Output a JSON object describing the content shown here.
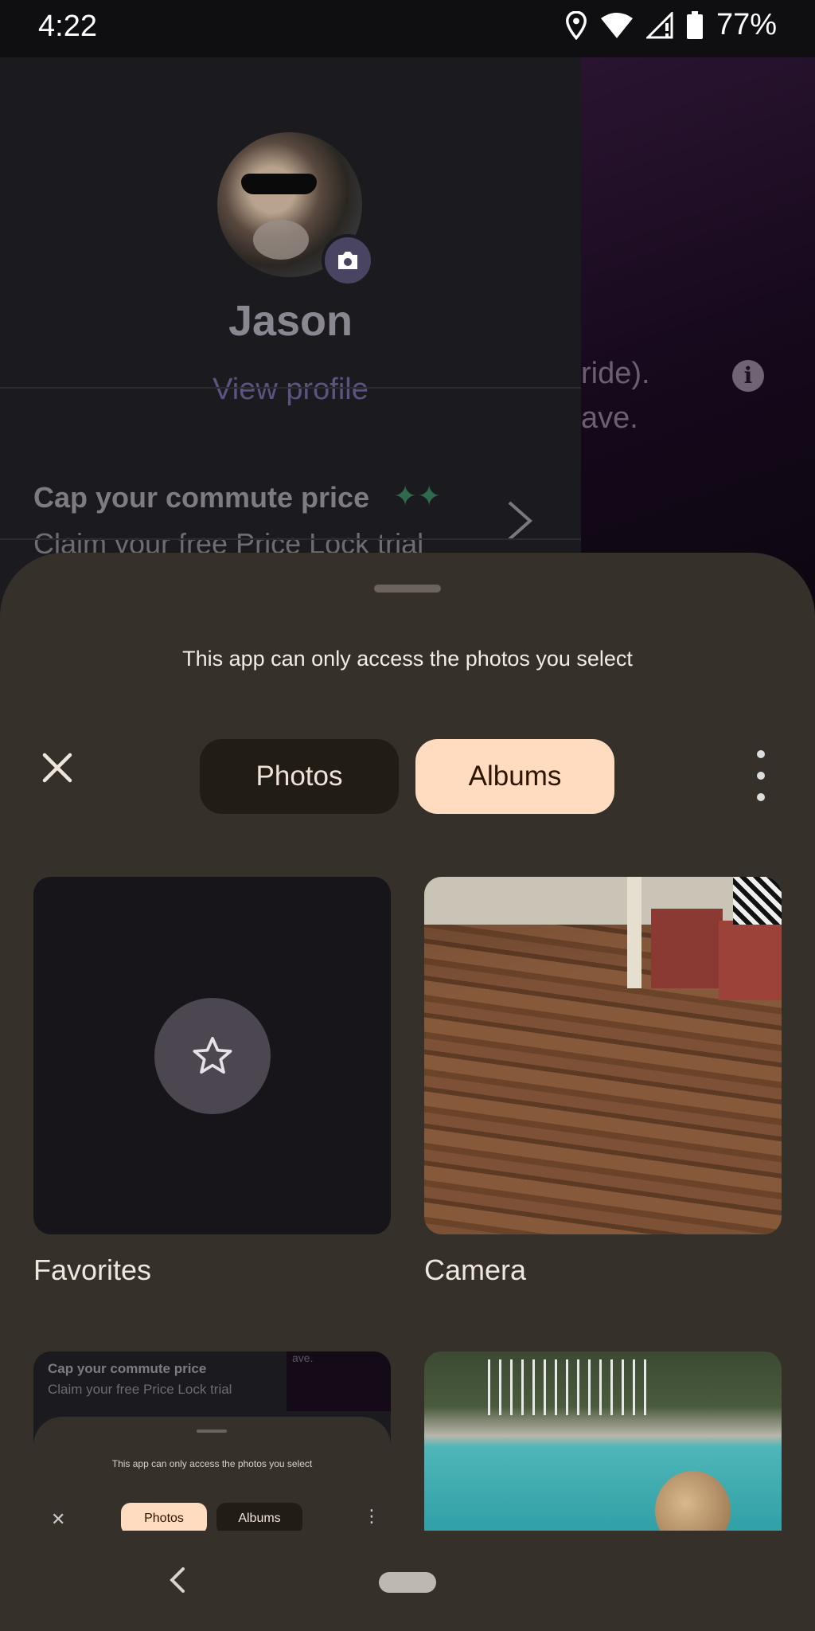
{
  "status_bar": {
    "time": "4:22",
    "battery": "77%"
  },
  "background_app": {
    "profile_name": "Jason",
    "view_profile_link": "View profile",
    "promo_title": "Cap your commute price",
    "promo_subtitle": "Claim your free Price Lock trial",
    "right_text_line1": "ride).",
    "right_text_line2": "ave."
  },
  "sheet": {
    "message": "This app can only access the photos you select",
    "tabs": [
      {
        "label": "Photos",
        "selected": false
      },
      {
        "label": "Albums",
        "selected": true
      }
    ],
    "accent_color": "#ffdcc0",
    "albums": [
      {
        "label": "Favorites",
        "thumb": "star-icon"
      },
      {
        "label": "Camera",
        "thumb": "floor-photo"
      }
    ],
    "row2": {
      "screenshot_thumb": {
        "promo_title": "Cap your commute price",
        "promo_subtitle": "Claim your free Price Lock trial",
        "right_fragment": "ave.",
        "message": "This app can only access the photos you select",
        "tab_photos": "Photos",
        "tab_albums": "Albums"
      },
      "pool_thumb": "pool-photo"
    }
  }
}
